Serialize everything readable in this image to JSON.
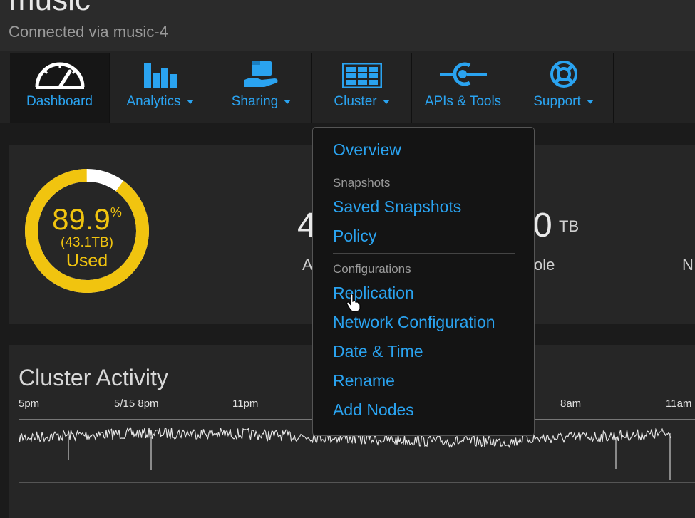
{
  "header": {
    "title": "music",
    "subtitle": "Connected via music-4"
  },
  "nav": {
    "tabs": [
      {
        "label": "Dashboard",
        "icon": "gauge-icon"
      },
      {
        "label": "Analytics",
        "icon": "bar-chart-icon"
      },
      {
        "label": "Sharing",
        "icon": "hand-folder-icon"
      },
      {
        "label": "Cluster",
        "icon": "cluster-grid-icon"
      },
      {
        "label": "APIs & Tools",
        "icon": "api-plug-icon"
      },
      {
        "label": "Support",
        "icon": "life-ring-icon"
      }
    ]
  },
  "usage": {
    "percent": "89.9",
    "percent_sign": "%",
    "used_tb": "(43.1TB)",
    "used_label": "Used",
    "stat1_value": "4",
    "stat1_label": "A",
    "stat2_value": "0",
    "stat2_unit": "TB",
    "stat2_label": "ole",
    "stat3_label": "N"
  },
  "activity": {
    "title": "Cluster Activity",
    "ticks": [
      "5pm",
      "5/15 8pm",
      "11pm",
      "8am",
      "11am"
    ]
  },
  "cluster_menu": {
    "overview": "Overview",
    "snapshots_header": "Snapshots",
    "saved_snapshots": "Saved Snapshots",
    "policy": "Policy",
    "configurations_header": "Configurations",
    "replication": "Replication",
    "network_configuration": "Network Configuration",
    "date_time": "Date & Time",
    "rename": "Rename",
    "add_nodes": "Add Nodes"
  },
  "colors": {
    "accent": "#2aa3f0",
    "gauge": "#f1c40f"
  }
}
